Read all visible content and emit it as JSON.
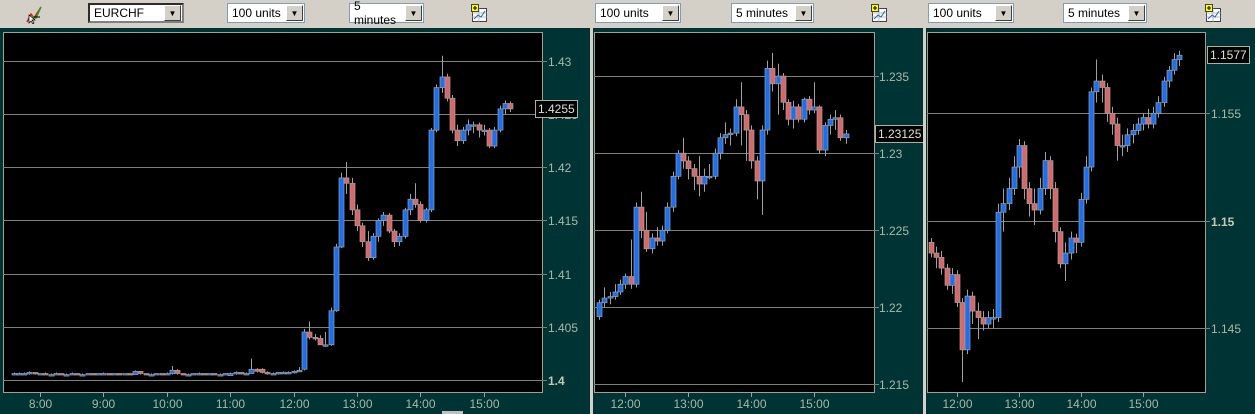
{
  "toolbar": {
    "symbol": "EURCHF",
    "panels": [
      {
        "units": "100 units",
        "interval": "5 minutes"
      },
      {
        "units": "100 units",
        "interval": "5 minutes"
      },
      {
        "units": "100 units",
        "interval": "5 minutes"
      }
    ]
  },
  "colors": {
    "up": "#1a70f0",
    "down": "#d86868",
    "wick": "#a0a0a0",
    "grid": "#808078",
    "bg": "#000000",
    "frame": "#003333"
  },
  "chart_data": [
    {
      "type": "candlestick",
      "interval_min": 5,
      "start": "7:35",
      "xlim": [
        "7:25",
        "15:55"
      ],
      "ylim": [
        1.39886,
        1.43273
      ],
      "yticks": [
        "1.4",
        "1.405",
        "1.41",
        "1.415",
        "1.42",
        "1.425",
        "1.43"
      ],
      "bold_tick": "1.4",
      "xticks": [
        "8:00",
        "9:00",
        "10:00",
        "11:00",
        "12:00",
        "13:00",
        "14:00",
        "15:00"
      ],
      "last_price": "1.4255",
      "candles": [
        [
          1.4006,
          1.4007,
          1.4005,
          1.4006
        ],
        [
          1.4006,
          1.4007,
          1.4005,
          1.4006
        ],
        [
          1.4006,
          1.4007,
          1.4005,
          1.4006
        ],
        [
          1.4006,
          1.4008,
          1.4005,
          1.4007
        ],
        [
          1.4007,
          1.4007,
          1.4005,
          1.4006
        ],
        [
          1.4006,
          1.4006,
          1.4005,
          1.4006
        ],
        [
          1.4006,
          1.4007,
          1.4005,
          1.4005
        ],
        [
          1.4005,
          1.4006,
          1.4005,
          1.4005
        ],
        [
          1.4005,
          1.4007,
          1.4005,
          1.4006
        ],
        [
          1.4006,
          1.4006,
          1.4005,
          1.4005
        ],
        [
          1.4005,
          1.4006,
          1.4005,
          1.4005
        ],
        [
          1.4005,
          1.4007,
          1.4005,
          1.4006
        ],
        [
          1.4006,
          1.4006,
          1.4005,
          1.4005
        ],
        [
          1.4005,
          1.4006,
          1.4004,
          1.4005
        ],
        [
          1.4005,
          1.4006,
          1.4005,
          1.4006
        ],
        [
          1.4006,
          1.4006,
          1.4005,
          1.4005
        ],
        [
          1.4005,
          1.4006,
          1.4005,
          1.4006
        ],
        [
          1.4006,
          1.4007,
          1.4005,
          1.4006
        ],
        [
          1.4006,
          1.4006,
          1.4005,
          1.4005
        ],
        [
          1.4005,
          1.4006,
          1.4005,
          1.4006
        ],
        [
          1.4006,
          1.4006,
          1.4005,
          1.4005
        ],
        [
          1.4005,
          1.4006,
          1.4005,
          1.4006
        ],
        [
          1.4006,
          1.4006,
          1.4005,
          1.4005
        ],
        [
          1.4005,
          1.4009,
          1.4005,
          1.4008
        ],
        [
          1.4008,
          1.4008,
          1.4005,
          1.4006
        ],
        [
          1.4006,
          1.4006,
          1.4005,
          1.4005
        ],
        [
          1.4005,
          1.4006,
          1.4005,
          1.4005
        ],
        [
          1.4005,
          1.4006,
          1.4005,
          1.4006
        ],
        [
          1.4006,
          1.4006,
          1.4005,
          1.4005
        ],
        [
          1.4005,
          1.4007,
          1.4005,
          1.4006
        ],
        [
          1.4006,
          1.4013,
          1.4005,
          1.4009
        ],
        [
          1.4009,
          1.401,
          1.4005,
          1.4006
        ],
        [
          1.4006,
          1.4006,
          1.4005,
          1.4005
        ],
        [
          1.4005,
          1.4006,
          1.4005,
          1.4005
        ],
        [
          1.4005,
          1.4006,
          1.4005,
          1.4006
        ],
        [
          1.4006,
          1.4007,
          1.4005,
          1.4006
        ],
        [
          1.4006,
          1.4006,
          1.4005,
          1.4005
        ],
        [
          1.4005,
          1.4006,
          1.4005,
          1.4006
        ],
        [
          1.4006,
          1.4006,
          1.4005,
          1.4005
        ],
        [
          1.4005,
          1.4006,
          1.4004,
          1.4005
        ],
        [
          1.4005,
          1.4006,
          1.4005,
          1.4006
        ],
        [
          1.4004,
          1.4007,
          1.4004,
          1.4006
        ],
        [
          1.4006,
          1.4008,
          1.4005,
          1.4007
        ],
        [
          1.4007,
          1.4007,
          1.4005,
          1.4006
        ],
        [
          1.4006,
          1.4007,
          1.4005,
          1.4006
        ],
        [
          1.4006,
          1.402,
          1.4006,
          1.401
        ],
        [
          1.401,
          1.4011,
          1.4007,
          1.4008
        ],
        [
          1.401,
          1.4011,
          1.4006,
          1.4007
        ],
        [
          1.4007,
          1.4008,
          1.4005,
          1.4006
        ],
        [
          1.4006,
          1.4007,
          1.4005,
          1.4006
        ],
        [
          1.4006,
          1.4007,
          1.4005,
          1.4007
        ],
        [
          1.4007,
          1.4008,
          1.4006,
          1.4007
        ],
        [
          1.4007,
          1.4008,
          1.4006,
          1.4007
        ],
        [
          1.4007,
          1.4009,
          1.4006,
          1.4008
        ],
        [
          1.4008,
          1.4012,
          1.4008,
          1.4009
        ],
        [
          1.401,
          1.4048,
          1.4009,
          1.4045
        ],
        [
          1.4045,
          1.4055,
          1.4038,
          1.404
        ],
        [
          1.404,
          1.4043,
          1.4037,
          1.4039
        ],
        [
          1.4039,
          1.4042,
          1.4033,
          1.4033
        ],
        [
          1.4032,
          1.4045,
          1.4031,
          1.4033
        ],
        [
          1.4033,
          1.4068,
          1.4032,
          1.4065
        ],
        [
          1.4065,
          1.4128,
          1.4064,
          1.4125
        ],
        [
          1.4125,
          1.4195,
          1.4124,
          1.419
        ],
        [
          1.419,
          1.4205,
          1.4175,
          1.4185
        ],
        [
          1.4185,
          1.419,
          1.4155,
          1.416
        ],
        [
          1.416,
          1.4165,
          1.414,
          1.4145
        ],
        [
          1.4145,
          1.4148,
          1.4125,
          1.413
        ],
        [
          1.413,
          1.414,
          1.4112,
          1.4115
        ],
        [
          1.4115,
          1.4138,
          1.4113,
          1.4135
        ],
        [
          1.4135,
          1.4152,
          1.413,
          1.415
        ],
        [
          1.415,
          1.4158,
          1.4145,
          1.4155
        ],
        [
          1.4155,
          1.4157,
          1.4138,
          1.414
        ],
        [
          1.414,
          1.4142,
          1.4125,
          1.413
        ],
        [
          1.413,
          1.4138,
          1.4126,
          1.4135
        ],
        [
          1.4135,
          1.4162,
          1.4133,
          1.416
        ],
        [
          1.416,
          1.4175,
          1.4155,
          1.417
        ],
        [
          1.417,
          1.4185,
          1.4162,
          1.4165
        ],
        [
          1.4165,
          1.4168,
          1.4148,
          1.415
        ],
        [
          1.415,
          1.4162,
          1.4148,
          1.416
        ],
        [
          1.416,
          1.4237,
          1.4158,
          1.4235
        ],
        [
          1.4235,
          1.4278,
          1.4233,
          1.4275
        ],
        [
          1.4275,
          1.4305,
          1.427,
          1.4285
        ],
        [
          1.4285,
          1.4288,
          1.4262,
          1.4265
        ],
        [
          1.4265,
          1.4268,
          1.4232,
          1.4235
        ],
        [
          1.4235,
          1.424,
          1.422,
          1.4225
        ],
        [
          1.4225,
          1.4238,
          1.4222,
          1.4235
        ],
        [
          1.4235,
          1.4245,
          1.423,
          1.424
        ],
        [
          1.424,
          1.4243,
          1.4232,
          1.424
        ],
        [
          1.424,
          1.4242,
          1.4228,
          1.4235
        ],
        [
          1.4235,
          1.424,
          1.423,
          1.4235
        ],
        [
          1.4235,
          1.4237,
          1.4218,
          1.422
        ],
        [
          1.422,
          1.4238,
          1.4218,
          1.4235
        ],
        [
          1.4235,
          1.4258,
          1.4233,
          1.4255
        ],
        [
          1.4255,
          1.4263,
          1.425,
          1.426
        ],
        [
          1.426,
          1.4262,
          1.4252,
          1.4255
        ]
      ]
    },
    {
      "type": "candlestick",
      "interval_min": 5,
      "start": "11:35",
      "xlim": [
        "11:30",
        "15:57"
      ],
      "ylim": [
        1.21451,
        1.23786
      ],
      "yticks": [
        "1.215",
        "1.22",
        "1.225",
        "1.23",
        "1.235"
      ],
      "bold_tick": "",
      "xticks": [
        "12:00",
        "13:00",
        "14:00",
        "15:00"
      ],
      "last_price": "1.23125",
      "candles": [
        [
          1.2194,
          1.2205,
          1.2192,
          1.2203
        ],
        [
          1.2203,
          1.2213,
          1.22,
          1.2206
        ],
        [
          1.2206,
          1.221,
          1.2202,
          1.2207
        ],
        [
          1.2207,
          1.2215,
          1.2205,
          1.221
        ],
        [
          1.221,
          1.2218,
          1.2208,
          1.2215
        ],
        [
          1.2215,
          1.2222,
          1.2212,
          1.222
        ],
        [
          1.222,
          1.2244,
          1.2212,
          1.2215
        ],
        [
          1.2215,
          1.2268,
          1.2213,
          1.2265
        ],
        [
          1.2265,
          1.2275,
          1.2245,
          1.225
        ],
        [
          1.225,
          1.2262,
          1.2236,
          1.2238
        ],
        [
          1.2238,
          1.2248,
          1.2235,
          1.2245
        ],
        [
          1.2245,
          1.2252,
          1.224,
          1.2243
        ],
        [
          1.2243,
          1.2253,
          1.224,
          1.225
        ],
        [
          1.225,
          1.2268,
          1.2248,
          1.2265
        ],
        [
          1.2265,
          1.2288,
          1.2262,
          1.2285
        ],
        [
          1.2285,
          1.2302,
          1.2283,
          1.23
        ],
        [
          1.23,
          1.231,
          1.229,
          1.2295
        ],
        [
          1.2295,
          1.2298,
          1.2283,
          1.229
        ],
        [
          1.229,
          1.2293,
          1.2276,
          1.2285
        ],
        [
          1.2285,
          1.2298,
          1.2272,
          1.228
        ],
        [
          1.228,
          1.229,
          1.2275,
          1.2285
        ],
        [
          1.2285,
          1.2293,
          1.2283,
          1.2285
        ],
        [
          1.2285,
          1.2303,
          1.2283,
          1.23
        ],
        [
          1.23,
          1.2313,
          1.2296,
          1.231
        ],
        [
          1.231,
          1.232,
          1.2306,
          1.2312
        ],
        [
          1.2312,
          1.2316,
          1.2305,
          1.2313
        ],
        [
          1.2313,
          1.2335,
          1.2311,
          1.233
        ],
        [
          1.233,
          1.2346,
          1.2305,
          1.2325
        ],
        [
          1.2325,
          1.2328,
          1.2295,
          1.2315
        ],
        [
          1.2315,
          1.2318,
          1.229,
          1.2295
        ],
        [
          1.2295,
          1.2298,
          1.227,
          1.2282
        ],
        [
          1.2282,
          1.2318,
          1.226,
          1.2315
        ],
        [
          1.2315,
          1.236,
          1.2312,
          1.2355
        ],
        [
          1.2355,
          1.2365,
          1.234,
          1.2345
        ],
        [
          1.2345,
          1.2358,
          1.2325,
          1.235
        ],
        [
          1.235,
          1.2352,
          1.2328,
          1.2333
        ],
        [
          1.2333,
          1.2335,
          1.2318,
          1.2322
        ],
        [
          1.2322,
          1.2334,
          1.2316,
          1.233
        ],
        [
          1.233,
          1.2332,
          1.232,
          1.2322
        ],
        [
          1.2322,
          1.2336,
          1.232,
          1.2335
        ],
        [
          1.2335,
          1.2337,
          1.2325,
          1.2328
        ],
        [
          1.2328,
          1.2346,
          1.2326,
          1.233
        ],
        [
          1.233,
          1.2331,
          1.23,
          1.2302
        ],
        [
          1.2302,
          1.232,
          1.2298,
          1.2318
        ],
        [
          1.2318,
          1.2325,
          1.2312,
          1.2322
        ],
        [
          1.2322,
          1.2328,
          1.2315,
          1.2323
        ],
        [
          1.2323,
          1.2325,
          1.2308,
          1.231
        ],
        [
          1.231,
          1.2315,
          1.2306,
          1.23125
        ]
      ]
    },
    {
      "type": "candlestick",
      "interval_min": 5,
      "start": "11:35",
      "xlim": [
        "11:31",
        "16:00"
      ],
      "ylim": [
        1.14204,
        1.15878
      ],
      "yticks": [
        "1.145",
        "1.15",
        "1.155"
      ],
      "bold_tick": "1.15",
      "xticks": [
        "12:00",
        "13:00",
        "14:00",
        "15:00"
      ],
      "last_price": "1.1577",
      "candles": [
        [
          1.149,
          1.1492,
          1.1483,
          1.1485
        ],
        [
          1.1485,
          1.1488,
          1.1478,
          1.1483
        ],
        [
          1.1483,
          1.1486,
          1.1475,
          1.1478
        ],
        [
          1.1478,
          1.148,
          1.1468,
          1.147
        ],
        [
          1.147,
          1.1478,
          1.1466,
          1.1475
        ],
        [
          1.1475,
          1.1477,
          1.146,
          1.1462
        ],
        [
          1.1462,
          1.1464,
          1.1425,
          1.144
        ],
        [
          1.144,
          1.1468,
          1.1438,
          1.1465
        ],
        [
          1.1465,
          1.1467,
          1.1452,
          1.1458
        ],
        [
          1.1458,
          1.1462,
          1.1445,
          1.1455
        ],
        [
          1.1455,
          1.1458,
          1.1449,
          1.1452
        ],
        [
          1.1452,
          1.1458,
          1.145,
          1.1455
        ],
        [
          1.1455,
          1.1459,
          1.145,
          1.1455
        ],
        [
          1.1455,
          1.1508,
          1.1453,
          1.1504
        ],
        [
          1.1504,
          1.1515,
          1.1495,
          1.1508
        ],
        [
          1.1508,
          1.152,
          1.1505,
          1.1515
        ],
        [
          1.1515,
          1.153,
          1.1512,
          1.1525
        ],
        [
          1.1525,
          1.1538,
          1.152,
          1.1535
        ],
        [
          1.1535,
          1.1537,
          1.151,
          1.1515
        ],
        [
          1.1515,
          1.1518,
          1.1502,
          1.1508
        ],
        [
          1.1508,
          1.1515,
          1.1498,
          1.1505
        ],
        [
          1.1505,
          1.152,
          1.1503,
          1.1515
        ],
        [
          1.1515,
          1.1532,
          1.1512,
          1.1528
        ],
        [
          1.1528,
          1.153,
          1.151,
          1.1515
        ],
        [
          1.1515,
          1.1518,
          1.149,
          1.1495
        ],
        [
          1.1495,
          1.1497,
          1.1478,
          1.148
        ],
        [
          1.148,
          1.149,
          1.1472,
          1.1485
        ],
        [
          1.1485,
          1.1495,
          1.1482,
          1.1492
        ],
        [
          1.1492,
          1.1494,
          1.1485,
          1.149
        ],
        [
          1.149,
          1.1513,
          1.1488,
          1.151
        ],
        [
          1.151,
          1.153,
          1.1508,
          1.1525
        ],
        [
          1.1525,
          1.1562,
          1.1523,
          1.156
        ],
        [
          1.156,
          1.1575,
          1.1555,
          1.1565
        ],
        [
          1.1565,
          1.1568,
          1.1555,
          1.1562
        ],
        [
          1.1562,
          1.1564,
          1.1546,
          1.155
        ],
        [
          1.155,
          1.1553,
          1.154,
          1.1545
        ],
        [
          1.1545,
          1.1548,
          1.1528,
          1.1535
        ],
        [
          1.1535,
          1.154,
          1.153,
          1.1535
        ],
        [
          1.1535,
          1.1543,
          1.1532,
          1.154
        ],
        [
          1.154,
          1.1545,
          1.1536,
          1.1542
        ],
        [
          1.1542,
          1.1548,
          1.154,
          1.1545
        ],
        [
          1.1545,
          1.155,
          1.1542,
          1.1548
        ],
        [
          1.1548,
          1.1552,
          1.1543,
          1.1545
        ],
        [
          1.1545,
          1.1553,
          1.1543,
          1.155
        ],
        [
          1.155,
          1.1558,
          1.1548,
          1.1555
        ],
        [
          1.1555,
          1.1567,
          1.1553,
          1.1565
        ],
        [
          1.1565,
          1.1572,
          1.1562,
          1.157
        ],
        [
          1.157,
          1.1578,
          1.1568,
          1.1575
        ],
        [
          1.1575,
          1.1579,
          1.1572,
          1.1577
        ]
      ]
    }
  ]
}
